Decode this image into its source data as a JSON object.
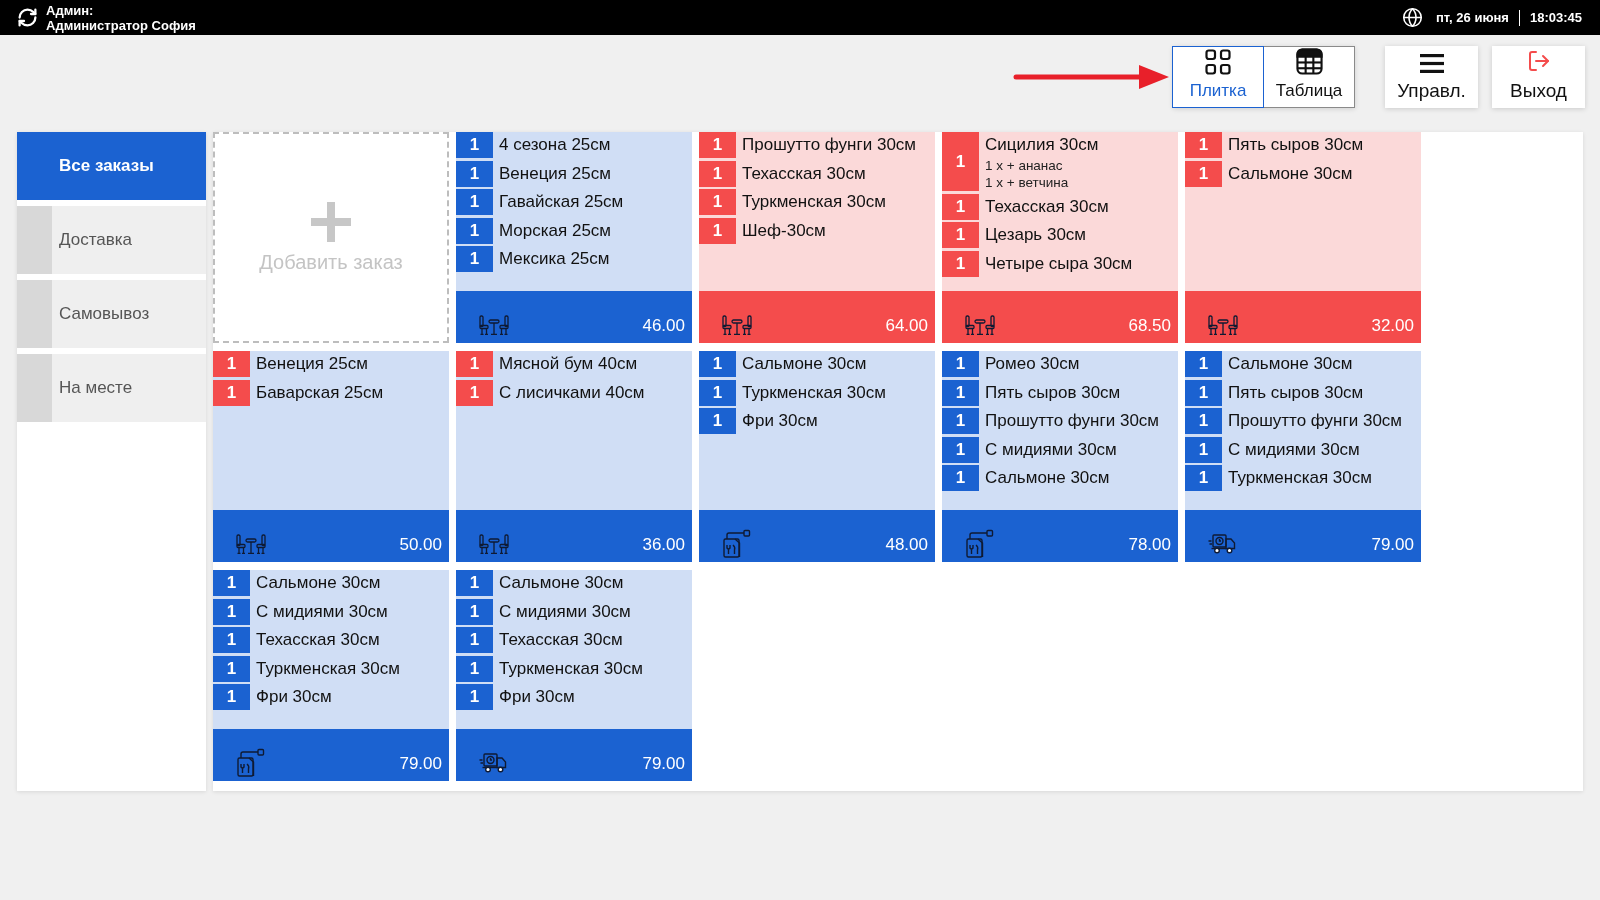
{
  "top_bar": {
    "role_label": "Админ:",
    "user_name": "Администратор София",
    "date": "пт, 26 июня",
    "time": "18:03:45"
  },
  "toolbar": {
    "view_tabs": [
      {
        "label": "Плитка",
        "kind": "tiles",
        "selected": true
      },
      {
        "label": "Таблица",
        "kind": "table",
        "selected": false
      }
    ],
    "buttons": [
      {
        "label": "Управл.",
        "kind": "menu"
      },
      {
        "label": "Выход",
        "kind": "exit"
      }
    ]
  },
  "sidebar": {
    "items": [
      {
        "label": "Все заказы",
        "selected": true
      },
      {
        "label": "Доставка",
        "selected": false
      },
      {
        "label": "Самовывоз",
        "selected": false
      },
      {
        "label": "На месте",
        "selected": false
      }
    ]
  },
  "add_order": {
    "label": "Добавить заказ"
  },
  "orders": [
    {
      "alert": false,
      "kind": "dinein",
      "total": "46.00",
      "items": [
        {
          "qty": "1",
          "name": "4 сезона 25см",
          "alert": false
        },
        {
          "qty": "1",
          "name": "Венеция 25см",
          "alert": false
        },
        {
          "qty": "1",
          "name": "Гавайская 25см",
          "alert": false
        },
        {
          "qty": "1",
          "name": "Морская 25см",
          "alert": false
        },
        {
          "qty": "1",
          "name": "Мексика 25см",
          "alert": false
        }
      ]
    },
    {
      "alert": true,
      "kind": "dinein",
      "total": "64.00",
      "items": [
        {
          "qty": "1",
          "name": "Прошутто фунги 30см",
          "alert": true
        },
        {
          "qty": "1",
          "name": "Техасская 30см",
          "alert": true
        },
        {
          "qty": "1",
          "name": "Туркменская 30см",
          "alert": true
        },
        {
          "qty": "1",
          "name": "Шеф-30см",
          "alert": true
        }
      ]
    },
    {
      "alert": true,
      "kind": "dinein",
      "total": "68.50",
      "items": [
        {
          "qty": "1",
          "name": "Сицилия 30см",
          "alert": true,
          "modifiers": [
            "1 x + ананас",
            "1 x + ветчина"
          ]
        },
        {
          "qty": "1",
          "name": "Техасская 30см",
          "alert": true
        },
        {
          "qty": "1",
          "name": "Цезарь 30см",
          "alert": true
        },
        {
          "qty": "1",
          "name": "Четыре сыра 30см",
          "alert": true
        }
      ]
    },
    {
      "alert": true,
      "kind": "dinein",
      "total": "32.00",
      "items": [
        {
          "qty": "1",
          "name": "Пять сыров 30см",
          "alert": true
        },
        {
          "qty": "1",
          "name": "Сальмоне 30см",
          "alert": true
        }
      ]
    },
    {
      "alert": false,
      "kind": "dinein",
      "total": "50.00",
      "items": [
        {
          "qty": "1",
          "name": "Венеция 25см",
          "alert": true
        },
        {
          "qty": "1",
          "name": "Баварская 25см",
          "alert": true
        }
      ]
    },
    {
      "alert": false,
      "kind": "dinein",
      "total": "36.00",
      "items": [
        {
          "qty": "1",
          "name": "Мясной бум 40см",
          "alert": true
        },
        {
          "qty": "1",
          "name": "С лисичками 40см",
          "alert": true
        }
      ]
    },
    {
      "alert": false,
      "kind": "takeaway",
      "total": "48.00",
      "items": [
        {
          "qty": "1",
          "name": "Сальмоне 30см",
          "alert": false
        },
        {
          "qty": "1",
          "name": "Туркменская 30см",
          "alert": false
        },
        {
          "qty": "1",
          "name": "Фри 30см",
          "alert": false
        }
      ]
    },
    {
      "alert": false,
      "kind": "takeaway",
      "total": "78.00",
      "items": [
        {
          "qty": "1",
          "name": "Ромео 30см",
          "alert": false
        },
        {
          "qty": "1",
          "name": "Пять сыров 30см",
          "alert": false
        },
        {
          "qty": "1",
          "name": "Прошутто фунги 30см",
          "alert": false
        },
        {
          "qty": "1",
          "name": "С мидиями 30см",
          "alert": false
        },
        {
          "qty": "1",
          "name": "Сальмоне 30см",
          "alert": false
        }
      ]
    },
    {
      "alert": false,
      "kind": "delivery",
      "total": "79.00",
      "items": [
        {
          "qty": "1",
          "name": "Сальмоне 30см",
          "alert": false
        },
        {
          "qty": "1",
          "name": "Пять сыров 30см",
          "alert": false
        },
        {
          "qty": "1",
          "name": "Прошутто фунги 30см",
          "alert": false
        },
        {
          "qty": "1",
          "name": "С мидиями 30см",
          "alert": false
        },
        {
          "qty": "1",
          "name": "Туркменская 30см",
          "alert": false
        }
      ]
    },
    {
      "alert": false,
      "kind": "takeaway",
      "total": "79.00",
      "items": [
        {
          "qty": "1",
          "name": "Сальмоне 30см",
          "alert": false
        },
        {
          "qty": "1",
          "name": "С мидиями 30см",
          "alert": false
        },
        {
          "qty": "1",
          "name": "Техасская 30см",
          "alert": false
        },
        {
          "qty": "1",
          "name": "Туркменская 30см",
          "alert": false
        },
        {
          "qty": "1",
          "name": "Фри 30см",
          "alert": false
        }
      ]
    },
    {
      "alert": false,
      "kind": "delivery",
      "total": "79.00",
      "items": [
        {
          "qty": "1",
          "name": "Сальмоне 30см",
          "alert": false
        },
        {
          "qty": "1",
          "name": "С мидиями 30см",
          "alert": false
        },
        {
          "qty": "1",
          "name": "Техасская 30см",
          "alert": false
        },
        {
          "qty": "1",
          "name": "Туркменская 30см",
          "alert": false
        },
        {
          "qty": "1",
          "name": "Фри 30см",
          "alert": false
        }
      ]
    }
  ]
}
